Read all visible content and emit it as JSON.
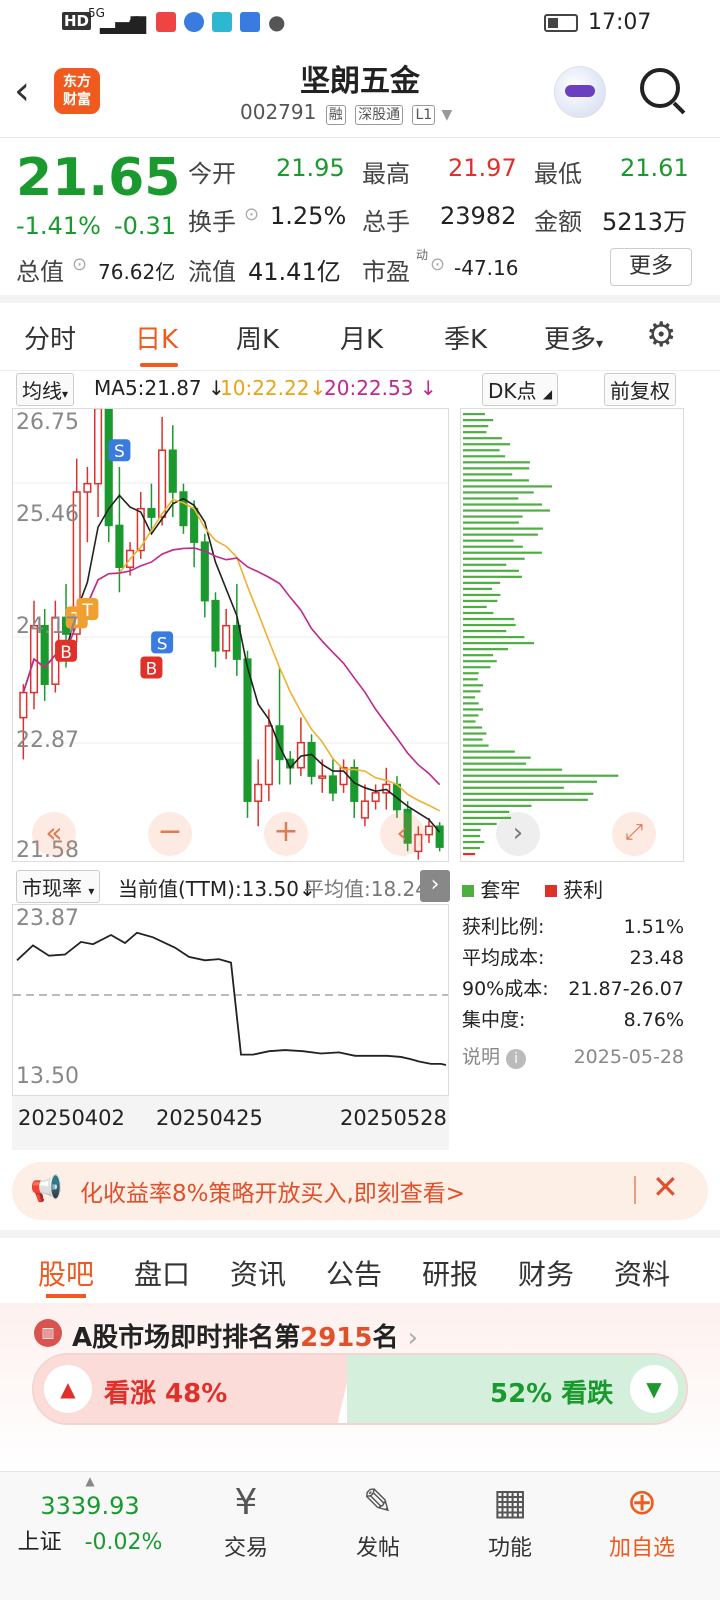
{
  "status": {
    "left_icons": [
      "HD",
      "5G"
    ],
    "time": "17:07"
  },
  "header": {
    "app_logo": "东方财富",
    "title": "坚朗五金",
    "code": "002791",
    "tags": [
      "融",
      "深股通",
      "L1"
    ]
  },
  "quote": {
    "price": "21.65",
    "change_pct": "-1.41%",
    "change": "-0.31",
    "open_label": "今开",
    "open": "21.95",
    "high_label": "最高",
    "high": "21.97",
    "low_label": "最低",
    "low": "21.61",
    "turnover_label": "换手",
    "turnover": "1.25%",
    "volume_label": "总手",
    "volume": "23982",
    "amount_label": "金额",
    "amount": "5213万",
    "mktcap_label": "总值",
    "mktcap": "76.62亿",
    "float_label": "流值",
    "float": "41.41亿",
    "pe_label": "市盈",
    "pe_sup": "动",
    "pe": "-47.16",
    "more": "更多"
  },
  "tabs": [
    "分时",
    "日K",
    "周K",
    "月K",
    "季K",
    "更多"
  ],
  "chart": {
    "ma_selector": "均线",
    "ma5": "MA5:21.87",
    "ma10": "10:22.22",
    "ma20": "20:22.53",
    "arrow": "↓",
    "dk_button": "DK点",
    "fq_button": "前复权",
    "price_ticks": [
      "26.75",
      "25.46",
      "24.17",
      "22.87",
      "21.58"
    ],
    "colors": {
      "up": "#e0302a",
      "down": "#1a9a2e",
      "ma5": "#222222",
      "ma10": "#f0b030",
      "ma20": "#c0278f"
    },
    "markers": [
      "B",
      "T",
      "T",
      "S",
      "B",
      "S"
    ]
  },
  "chip": {
    "legend_trapped": "套牢",
    "legend_profit": "获利",
    "profit_ratio_label": "获利比例:",
    "profit_ratio": "1.51%",
    "avg_cost_label": "平均成本:",
    "avg_cost": "23.48",
    "cost90_label": "90%成本:",
    "cost90": "21.87-26.07",
    "concentration_label": "集中度:",
    "concentration": "8.76%",
    "note_label": "说明",
    "date": "2025-05-28"
  },
  "indicator": {
    "selector": "市现率",
    "current": "当前值(TTM):13.50",
    "arrow": "↓",
    "average": "平均值:18.24",
    "ticks": [
      "23.87",
      "13.50"
    ],
    "dates": [
      "20250402",
      "20250425",
      "20250528"
    ]
  },
  "promo": {
    "text": "化收益率8%策略开放买入,即刻查看>"
  },
  "bottom_tabs": [
    "股吧",
    "盘口",
    "资讯",
    "公告",
    "研报",
    "财务",
    "资料"
  ],
  "rank": {
    "prefix": "A股市场即时排名第",
    "number": "2915",
    "suffix": "名",
    "bull": "看涨 48%",
    "bear": "52% 看跌",
    "bull_pct": 48
  },
  "bottombar": {
    "index_value": "3339.93",
    "index_name": "上证",
    "index_change": "-0.02%",
    "items": [
      "交易",
      "发帖",
      "功能",
      "加自选"
    ]
  }
}
